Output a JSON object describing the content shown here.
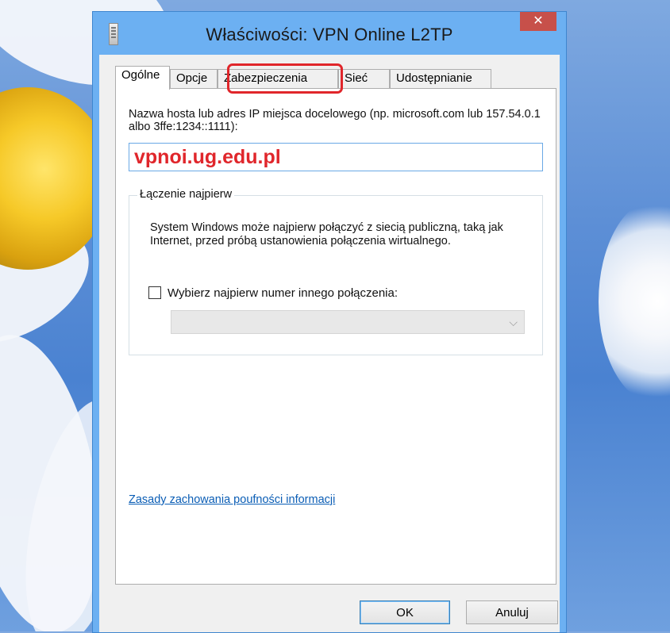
{
  "window": {
    "title": "Właściwości: VPN Online L2TP",
    "close_glyph": "✕"
  },
  "tabs": [
    {
      "label": "Ogólne",
      "active": true
    },
    {
      "label": "Opcje",
      "active": false
    },
    {
      "label": "Zabezpieczenia",
      "active": false
    },
    {
      "label": "Sieć",
      "active": false
    },
    {
      "label": "Udostępnianie",
      "active": false
    }
  ],
  "general": {
    "host_description": "Nazwa hosta lub adres IP miejsca docelowego (np. microsoft.com lub 157.54.0.1 albo 3ffe:1234::1111):",
    "host_value": "vpnoi.ug.edu.pl",
    "first_connect": {
      "title": "Łączenie najpierw",
      "text": "System Windows może najpierw połączyć z siecią publiczną, taką jak Internet, przed próbą ustanowienia połączenia wirtualnego.",
      "checkbox_label": "Wybierz najpierw numer innego połączenia:",
      "checkbox_checked": false,
      "select_value": ""
    },
    "privacy_link": "Zasady zachowania poufności informacji"
  },
  "buttons": {
    "ok": "OK",
    "cancel": "Anuluj"
  },
  "colors": {
    "highlight": "#e0262b",
    "host_text": "#e0262b",
    "titlebar": "#6cb0f2",
    "close": "#c7504a"
  }
}
